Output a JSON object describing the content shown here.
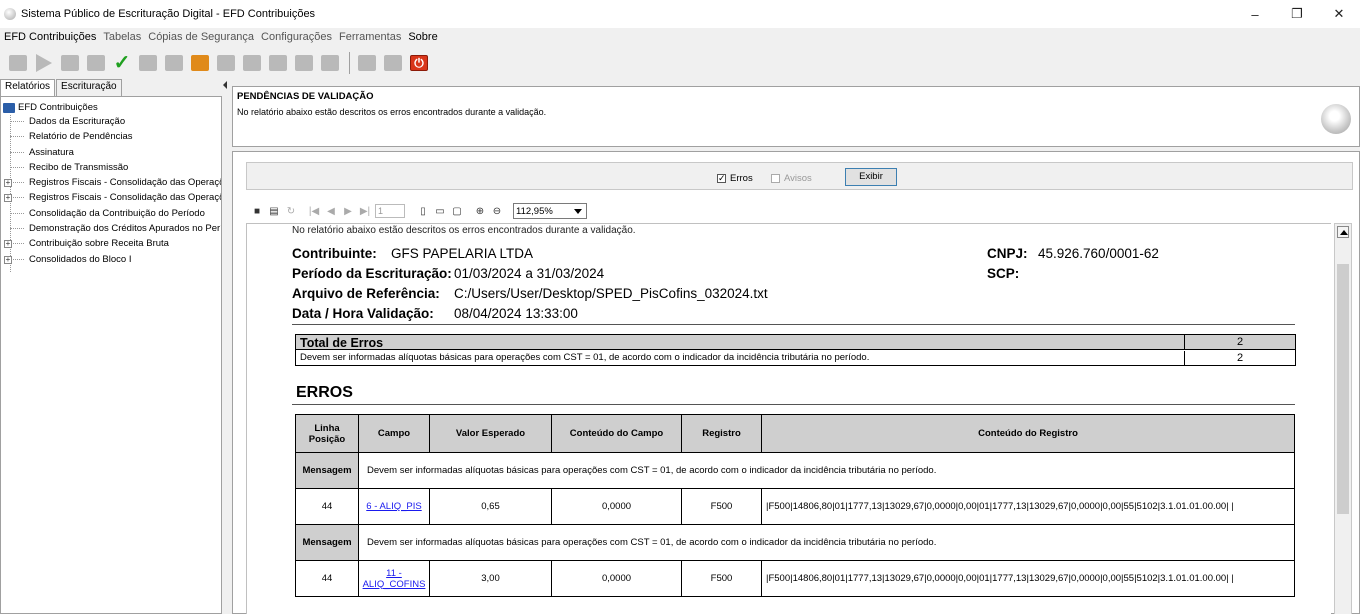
{
  "window": {
    "title": "Sistema Público de Escrituração Digital - EFD Contribuições",
    "controls": [
      "–",
      "❐",
      "✕"
    ]
  },
  "menu": [
    {
      "label": "EFD Contribuições",
      "enabled": true
    },
    {
      "label": "Tabelas",
      "enabled": false
    },
    {
      "label": "Cópias de Segurança",
      "enabled": false
    },
    {
      "label": "Configurações",
      "enabled": false
    },
    {
      "label": "Ferramentas",
      "enabled": false
    },
    {
      "label": "Sobre",
      "enabled": true
    }
  ],
  "left_tabs": [
    "Relatórios",
    "Escrituração"
  ],
  "tree": {
    "root": "EFD Contribuições",
    "items": [
      {
        "label": "Dados da Escrituração",
        "expandable": false
      },
      {
        "label": "Relatório de Pendências",
        "expandable": false
      },
      {
        "label": "Assinatura",
        "expandable": false
      },
      {
        "label": "Recibo de Transmissão",
        "expandable": false
      },
      {
        "label": "Registros Fiscais - Consolidação das Operaçõ",
        "expandable": true
      },
      {
        "label": "Registros Fiscais - Consolidação das Operaçõ",
        "expandable": true
      },
      {
        "label": "Consolidação da Contribuição do Período",
        "expandable": false
      },
      {
        "label": "Demonstração dos Créditos Apurados no Perí",
        "expandable": false
      },
      {
        "label": "Contribuição sobre Receita Bruta",
        "expandable": true
      },
      {
        "label": "Consolidados do Bloco I",
        "expandable": true
      }
    ]
  },
  "header": {
    "title": "PENDÊNCIAS DE VALIDAÇÃO",
    "subtitle": "No relatório abaixo estão descritos os erros encontrados durante a validação."
  },
  "filter": {
    "erros_label": "Erros",
    "erros_checked": "✓",
    "avisos_label": "Avisos",
    "exibir_label": "Exibir"
  },
  "report_toolbar": {
    "page": "1",
    "zoom": "112,95%"
  },
  "report": {
    "intro": "No relatório abaixo estão descritos os erros encontrados durante a validação.",
    "contribuinte_label": "Contribuinte:",
    "contribuinte_value": "GFS PAPELARIA LTDA",
    "cnpj_label": "CNPJ:",
    "cnpj_value": "45.926.760/0001-62",
    "periodo_label": "Período da Escrituração:",
    "periodo_value": "01/03/2024 a 31/03/2024",
    "scp_label": "SCP:",
    "arquivo_label": "Arquivo de Referência:",
    "arquivo_value": "C:/Users/User/Desktop/SPED_PisCofins_032024.txt",
    "datahora_label": "Data / Hora Validação:",
    "datahora_value": "08/04/2024 13:33:00",
    "total_label": "Total de Erros",
    "total_value": "2",
    "total_desc": "Devem ser informadas alíquotas básicas para operações com CST = 01, de acordo com o indicador da incidência tributária no período.",
    "total_desc_value": "2",
    "erros_title": "ERROS",
    "table_headers": {
      "linha": "Linha",
      "posicao": "Posição",
      "campo": "Campo",
      "valor_esperado": "Valor Esperado",
      "conteudo_campo": "Conteúdo do Campo",
      "registro": "Registro",
      "conteudo_registro": "Conteúdo do Registro"
    },
    "mensagem_label": "Mensagem",
    "errors": [
      {
        "mensagem": "Devem ser informadas alíquotas básicas para operações com CST = 01, de acordo com o indicador da incidência tributária no período.",
        "linha": "44",
        "campo_line1": "6 - ALIQ_PIS",
        "campo_line2": "",
        "valor_esperado": "0,65",
        "conteudo_campo": "0,0000",
        "registro": "F500",
        "conteudo_registro": "|F500|14806,80|01|1777,13|13029,67|0,0000|0,00|01|1777,13|13029,67|0,0000|0,00|55|5102|3.1.01.01.00.00| |"
      },
      {
        "mensagem": "Devem ser informadas alíquotas básicas para operações com CST = 01, de acordo com o indicador da incidência tributária no período.",
        "linha": "44",
        "campo_line1": "11 -",
        "campo_line2": "ALIQ_COFINS",
        "valor_esperado": "3,00",
        "conteudo_campo": "0,0000",
        "registro": "F500",
        "conteudo_registro": "|F500|14806,80|01|1777,13|13029,67|0,0000|0,00|01|1777,13|13029,67|0,0000|0,00|55|5102|3.1.01.01.00.00| |"
      }
    ]
  }
}
